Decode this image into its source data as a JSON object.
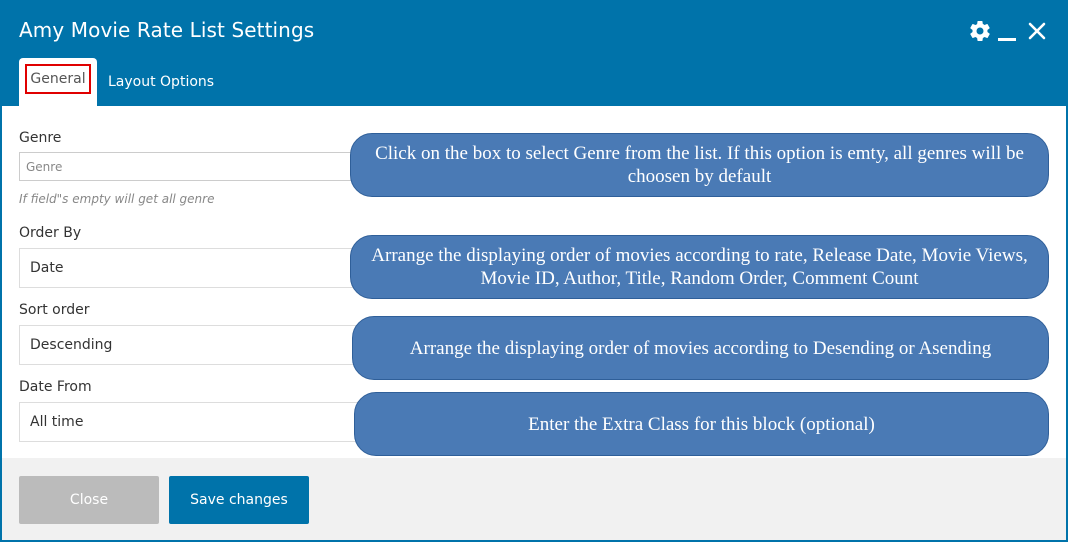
{
  "dialog": {
    "title": "Amy Movie Rate List Settings"
  },
  "header_icons": [
    "gear-icon",
    "minimize-icon",
    "close-icon"
  ],
  "tabs": [
    {
      "label": "General",
      "active": true
    },
    {
      "label": "Layout Options",
      "active": false
    }
  ],
  "fields": {
    "genre": {
      "label": "Genre",
      "placeholder": "Genre",
      "hint": "If field\"s empty will get all genre"
    },
    "order_by": {
      "label": "Order By",
      "value": "Date"
    },
    "sort_order": {
      "label": "Sort order",
      "value": "Descending"
    },
    "date_from": {
      "label": "Date From",
      "value": "All time"
    }
  },
  "annotations": [
    "Click on the box to select Genre from the list. If this option is emty, all genres will be choosen by default",
    "Arrange the displaying order of movies according to rate, Release Date, Movie Views, Movie ID, Author, Title, Random Order, Comment Count",
    "Arrange the displaying order of movies according to Desending or Asending",
    "Enter the Extra Class for this block (optional)"
  ],
  "footer": {
    "close_label": "Close",
    "save_label": "Save changes"
  },
  "colors": {
    "header": "#0073aa",
    "bubble": "#4a7ab5",
    "highlight": "#e00000",
    "close_button": "#bbbbbb",
    "save_button": "#0073aa"
  }
}
